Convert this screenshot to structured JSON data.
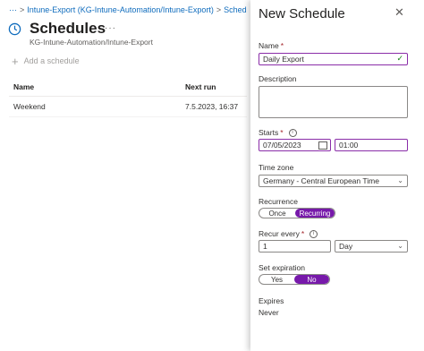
{
  "breadcrumb": {
    "more": "···",
    "item1": "Intune-Export (KG-Intune-Automation/Intune-Export)",
    "item2": "Sched"
  },
  "page": {
    "title": "Schedules",
    "more": "···",
    "subtitle": "KG-Intune-Automation/Intune-Export"
  },
  "toolbar": {
    "add_label": "Add a schedule"
  },
  "table": {
    "columns": [
      "Name",
      "Next run"
    ],
    "rows": [
      [
        "Weekend",
        "7.5.2023, 16:37"
      ]
    ]
  },
  "panel": {
    "title": "New Schedule",
    "name_label": "Name",
    "name_value": "Daily Export",
    "description_label": "Description",
    "starts_label": "Starts",
    "start_date": "07/05/2023",
    "start_time": "01:00",
    "timezone_label": "Time zone",
    "timezone_value": "Germany - Central European Time",
    "recurrence_label": "Recurrence",
    "recurrence_options": [
      "Once",
      "Recurring"
    ],
    "recurrence_selected": "Recurring",
    "recur_every_label": "Recur every",
    "recur_every_value": "1",
    "recur_unit": "Day",
    "expiration_label": "Set expiration",
    "expiration_options": [
      "Yes",
      "No"
    ],
    "expiration_selected": "No",
    "expires_label": "Expires",
    "expires_value": "Never"
  },
  "colors": {
    "accent": "#7719aa",
    "link": "#0f6cbd",
    "required": "#a4262c"
  }
}
